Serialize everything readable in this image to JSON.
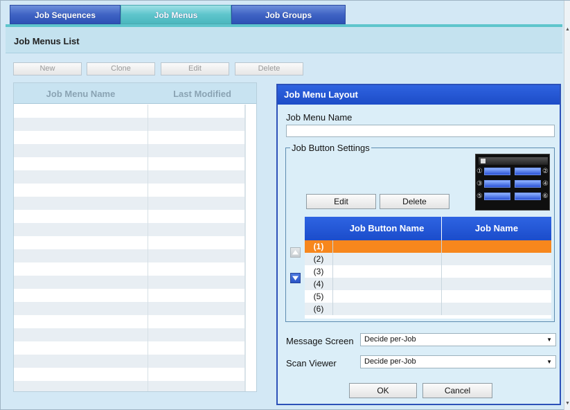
{
  "tabs": [
    {
      "label": "Job Sequences",
      "active": false
    },
    {
      "label": "Job Menus",
      "active": true
    },
    {
      "label": "Job Groups",
      "active": false
    }
  ],
  "list_title": "Job Menus List",
  "toolbar": {
    "new": "New",
    "clone": "Clone",
    "edit": "Edit",
    "delete": "Delete"
  },
  "left_table": {
    "headers": [
      "Job Menu Name",
      "Last Modified"
    ],
    "row_count": 22
  },
  "layout_panel": {
    "title": "Job Menu Layout",
    "name_label": "Job Menu Name",
    "name_value": "",
    "settings_legend": "Job Button Settings",
    "edit_button": "Edit",
    "delete_button": "Delete",
    "keypad_numbers": [
      "①",
      "②",
      "③",
      "④",
      "⑤",
      "⑥"
    ],
    "table_headers": [
      "",
      "Job Button Name",
      "Job Name"
    ],
    "rows": [
      {
        "num": "(1)",
        "button_name": "",
        "job_name": "",
        "selected": true
      },
      {
        "num": "(2)",
        "button_name": "",
        "job_name": "",
        "selected": false
      },
      {
        "num": "(3)",
        "button_name": "",
        "job_name": "",
        "selected": false
      },
      {
        "num": "(4)",
        "button_name": "",
        "job_name": "",
        "selected": false
      },
      {
        "num": "(5)",
        "button_name": "",
        "job_name": "",
        "selected": false
      },
      {
        "num": "(6)",
        "button_name": "",
        "job_name": "",
        "selected": false
      }
    ],
    "message_screen_label": "Message Screen",
    "message_screen_value": "Decide per-Job",
    "scan_viewer_label": "Scan Viewer",
    "scan_viewer_value": "Decide per-Job",
    "ok_button": "OK",
    "cancel_button": "Cancel"
  },
  "colors": {
    "accent": "#2c50b8",
    "selected_row": "#f7871d",
    "active_tab": "#5ec5cc"
  }
}
